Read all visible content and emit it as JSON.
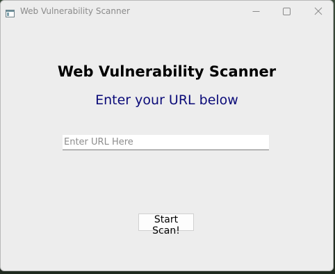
{
  "window": {
    "title": "Web Vulnerability Scanner",
    "app_icon": "window-app-icon",
    "controls": {
      "minimize_icon": "minimize-icon",
      "maximize_icon": "maximize-icon",
      "close_icon": "close-icon"
    }
  },
  "main": {
    "heading": "Web Vulnerability Scanner",
    "subheading": "Enter your URL below",
    "url_input": {
      "value": "",
      "placeholder": "Enter URL Here"
    },
    "scan_button_label": "Start Scan!"
  },
  "colors": {
    "window_bg": "#f0f0f0",
    "subheading": "#0a0a78",
    "heading": "#000000"
  }
}
